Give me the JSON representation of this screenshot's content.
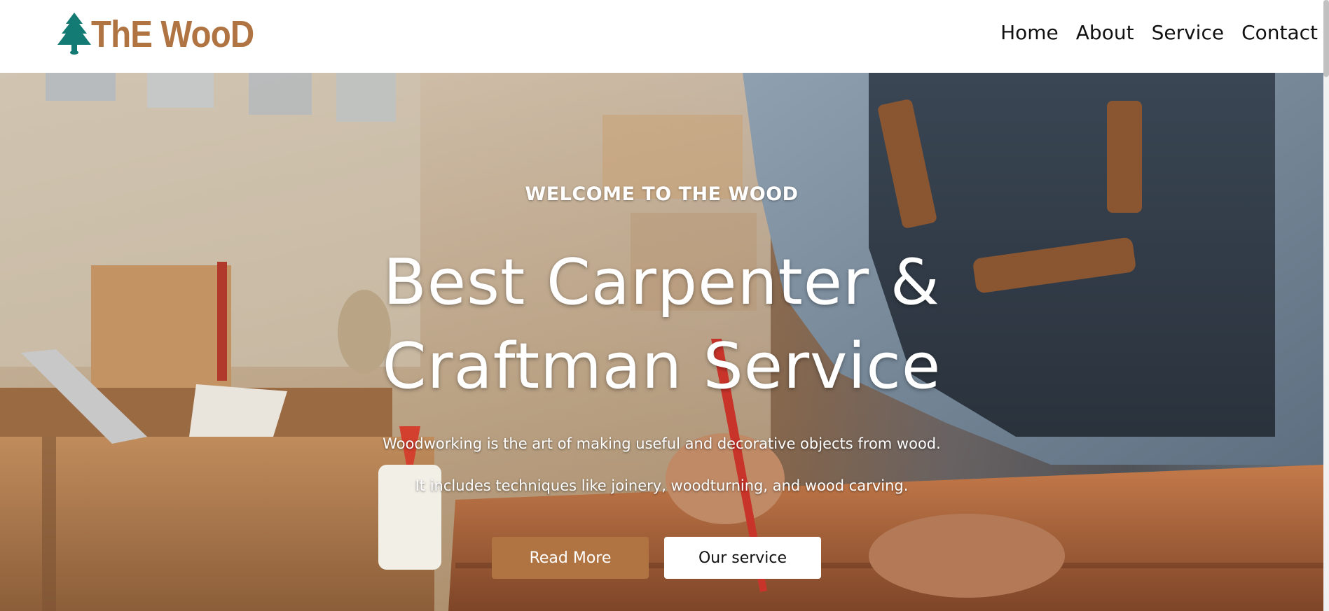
{
  "brand": {
    "name": "ThE WooD",
    "icon": "pine-tree-icon",
    "icon_color": "#147a74",
    "text_color": "#b07443"
  },
  "nav": {
    "items": [
      {
        "label": "Home"
      },
      {
        "label": "About"
      },
      {
        "label": "Service"
      },
      {
        "label": "Contact"
      }
    ]
  },
  "hero": {
    "eyebrow": "WELCOME TO THE WOOD",
    "headline_line1": "Best Carpenter &",
    "headline_line2": "Craftman Service",
    "description_line1": "Woodworking is the art of making useful and decorative objects from wood.",
    "description_line2": "It includes techniques like joinery, woodturning, and wood carving.",
    "primary_button": "Read More",
    "secondary_button": "Our service",
    "accent_color": "#b07443"
  }
}
